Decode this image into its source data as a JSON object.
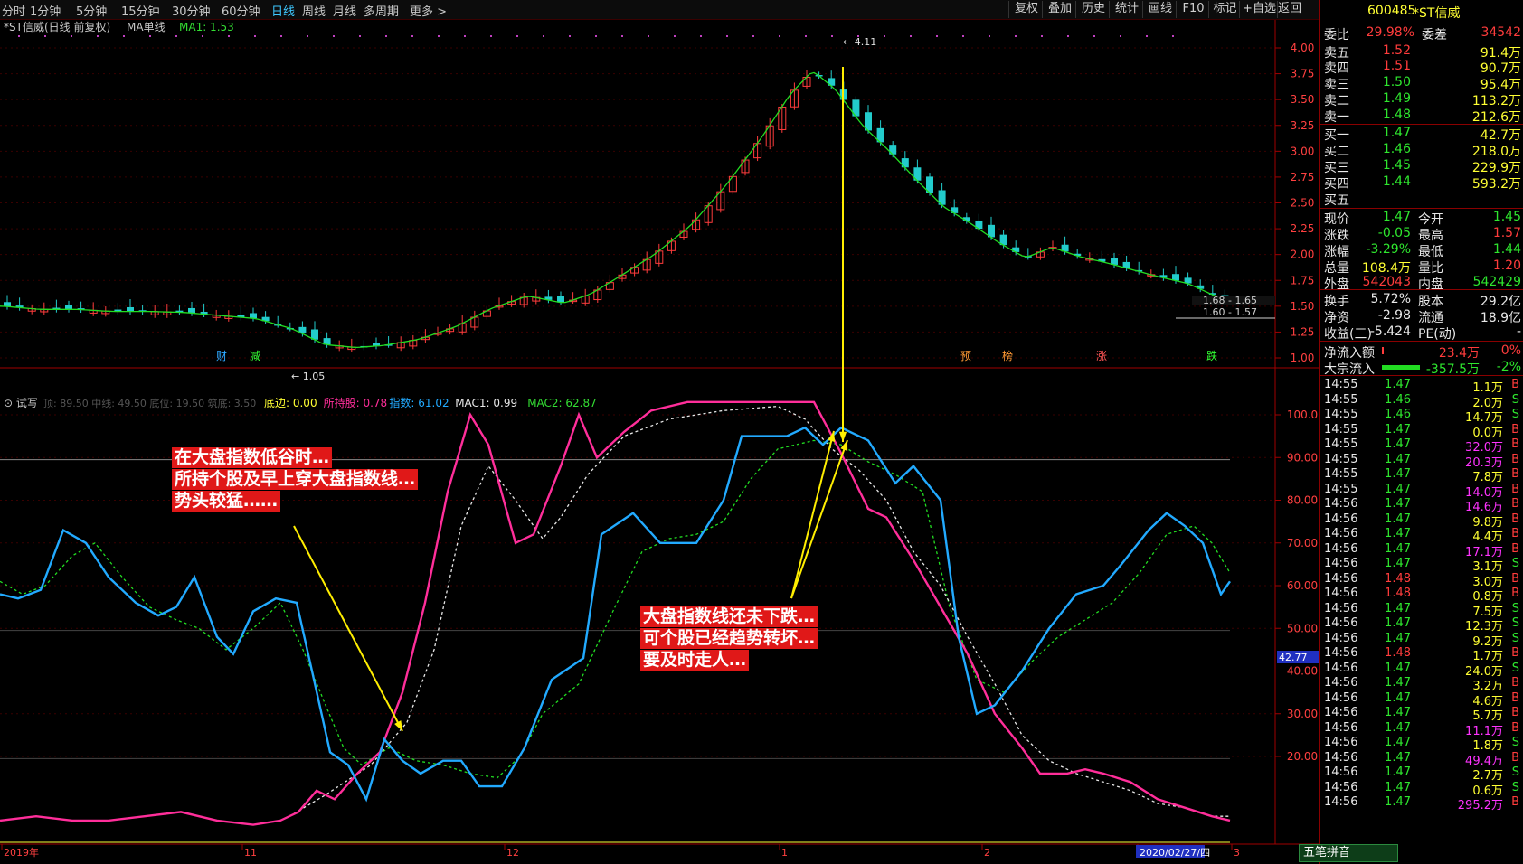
{
  "period_tabs": [
    "分时",
    "1分钟",
    "5分钟",
    "15分钟",
    "30分钟",
    "60分钟",
    "日线",
    "周线",
    "月线",
    "多周期",
    "更多 >"
  ],
  "active_tab": "日线",
  "right_buttons": [
    "复权",
    "叠加",
    "历史",
    "统计",
    "画线",
    "F10",
    "标记",
    "+自选",
    "返回"
  ],
  "main_chart": {
    "title": "*ST信威(日线 前复权)",
    "indicator": "MA单线",
    "ma_label": "MA1: 1.53",
    "y_ticks": [
      "4.00",
      "3.75",
      "3.50",
      "3.25",
      "3.00",
      "2.75",
      "2.50",
      "2.25",
      "2.00",
      "1.75",
      "1.50",
      "1.25",
      "1.00"
    ],
    "high_marker": "4.11",
    "low_marker": "1.05",
    "price_labels": [
      "1.68 - 1.65",
      "1.60 - 1.57"
    ],
    "events": [
      "财",
      "减",
      "预",
      "榜",
      "涨",
      "跌"
    ]
  },
  "sub_chart": {
    "title": "试写",
    "params": "顶: 89.50  中线: 49.50  底位: 19.50  筑底: 3.50",
    "legend": [
      {
        "label": "底边: 0.00",
        "color": "#ffff33"
      },
      {
        "label": "所持股: 0.78",
        "color": "#ff2e9a"
      },
      {
        "label": "指数: 61.02",
        "color": "#22aaff"
      },
      {
        "label": "MAC1: 0.99",
        "color": "#e8e8e8"
      },
      {
        "label": "MAC2: 62.87",
        "color": "#33dd33"
      }
    ],
    "y_ticks": [
      "100.0",
      "90.00",
      "80.00",
      "70.00",
      "60.00",
      "50.00",
      "40.00",
      "30.00",
      "20.00"
    ],
    "current_value": "42.77"
  },
  "x_axis": [
    "2019年",
    "11",
    "12",
    "1",
    "2",
    "2020/02/27/四",
    "3"
  ],
  "annotations": {
    "left": [
      "在大盘指数低谷时…",
      "所持个股及早上穿大盘指数线…",
      "势头较猛……"
    ],
    "right": [
      "大盘指数线还未下跌…",
      "可个股已经趋势转坏…",
      "要及时走人…"
    ]
  },
  "quote": {
    "code": "600485",
    "name": "*ST信威",
    "weibi_label": "委比",
    "weibi": "29.98%",
    "weicha_label": "委差",
    "weicha": "34542",
    "sells": [
      {
        "label": "卖五",
        "price": "1.52",
        "vol": "91.4万"
      },
      {
        "label": "卖四",
        "price": "1.51",
        "vol": "90.7万"
      },
      {
        "label": "卖三",
        "price": "1.50",
        "vol": "95.4万"
      },
      {
        "label": "卖二",
        "price": "1.49",
        "vol": "113.2万"
      },
      {
        "label": "卖一",
        "price": "1.48",
        "vol": "212.6万"
      }
    ],
    "buys": [
      {
        "label": "买一",
        "price": "1.47",
        "vol": "42.7万"
      },
      {
        "label": "买二",
        "price": "1.46",
        "vol": "218.0万"
      },
      {
        "label": "买三",
        "price": "1.45",
        "vol": "229.9万"
      },
      {
        "label": "买四",
        "price": "1.44",
        "vol": "593.2万"
      },
      {
        "label": "买五",
        "price": "",
        "vol": ""
      }
    ],
    "stats": [
      [
        "现价",
        "1.47",
        "今开",
        "1.45"
      ],
      [
        "涨跌",
        "-0.05",
        "最高",
        "1.57"
      ],
      [
        "涨幅",
        "-3.29%",
        "最低",
        "1.44"
      ],
      [
        "总量",
        "108.4万",
        "量比",
        "1.20"
      ],
      [
        "外盘",
        "542043",
        "内盘",
        "542429"
      ],
      [
        "换手",
        "5.72%",
        "股本",
        "29.2亿"
      ],
      [
        "净资",
        "-2.98",
        "流通",
        "18.9亿"
      ],
      [
        "收益(三)",
        "-5.424",
        "PE(动)",
        "-"
      ]
    ],
    "flows": [
      [
        "净流入额",
        "23.4万",
        "0%"
      ],
      [
        "大宗流入",
        "-357.5万",
        "-2%"
      ]
    ],
    "ticks": [
      [
        "14:55",
        "1.47",
        "1.1万",
        "B"
      ],
      [
        "14:55",
        "1.46",
        "2.0万",
        "S"
      ],
      [
        "14:55",
        "1.46",
        "14.7万",
        "S"
      ],
      [
        "14:55",
        "1.47",
        "0.0万",
        "B"
      ],
      [
        "14:55",
        "1.47",
        "32.0万",
        "B"
      ],
      [
        "14:55",
        "1.47",
        "20.3万",
        "B"
      ],
      [
        "14:55",
        "1.47",
        "7.8万",
        "B"
      ],
      [
        "14:55",
        "1.47",
        "14.0万",
        "B"
      ],
      [
        "14:56",
        "1.47",
        "14.6万",
        "B"
      ],
      [
        "14:56",
        "1.47",
        "9.8万",
        "B"
      ],
      [
        "14:56",
        "1.47",
        "4.4万",
        "B"
      ],
      [
        "14:56",
        "1.47",
        "17.1万",
        "B"
      ],
      [
        "14:56",
        "1.47",
        "3.1万",
        "S"
      ],
      [
        "14:56",
        "1.48",
        "3.0万",
        "B"
      ],
      [
        "14:56",
        "1.48",
        "0.8万",
        "B"
      ],
      [
        "14:56",
        "1.47",
        "7.5万",
        "S"
      ],
      [
        "14:56",
        "1.47",
        "12.3万",
        "S"
      ],
      [
        "14:56",
        "1.47",
        "9.2万",
        "S"
      ],
      [
        "14:56",
        "1.48",
        "1.7万",
        "B"
      ],
      [
        "14:56",
        "1.47",
        "24.0万",
        "S"
      ],
      [
        "14:56",
        "1.47",
        "3.2万",
        "B"
      ],
      [
        "14:56",
        "1.47",
        "4.6万",
        "B"
      ],
      [
        "14:56",
        "1.47",
        "5.7万",
        "B"
      ],
      [
        "14:56",
        "1.47",
        "11.1万",
        "B"
      ],
      [
        "14:56",
        "1.47",
        "1.8万",
        "S"
      ],
      [
        "14:56",
        "1.47",
        "49.4万",
        "B"
      ],
      [
        "14:56",
        "1.47",
        "2.7万",
        "S"
      ],
      [
        "14:56",
        "1.47",
        "0.6万",
        "S"
      ],
      [
        "14:56",
        "1.47",
        "295.2万",
        "B"
      ]
    ]
  },
  "ime": "五笔拼音"
}
